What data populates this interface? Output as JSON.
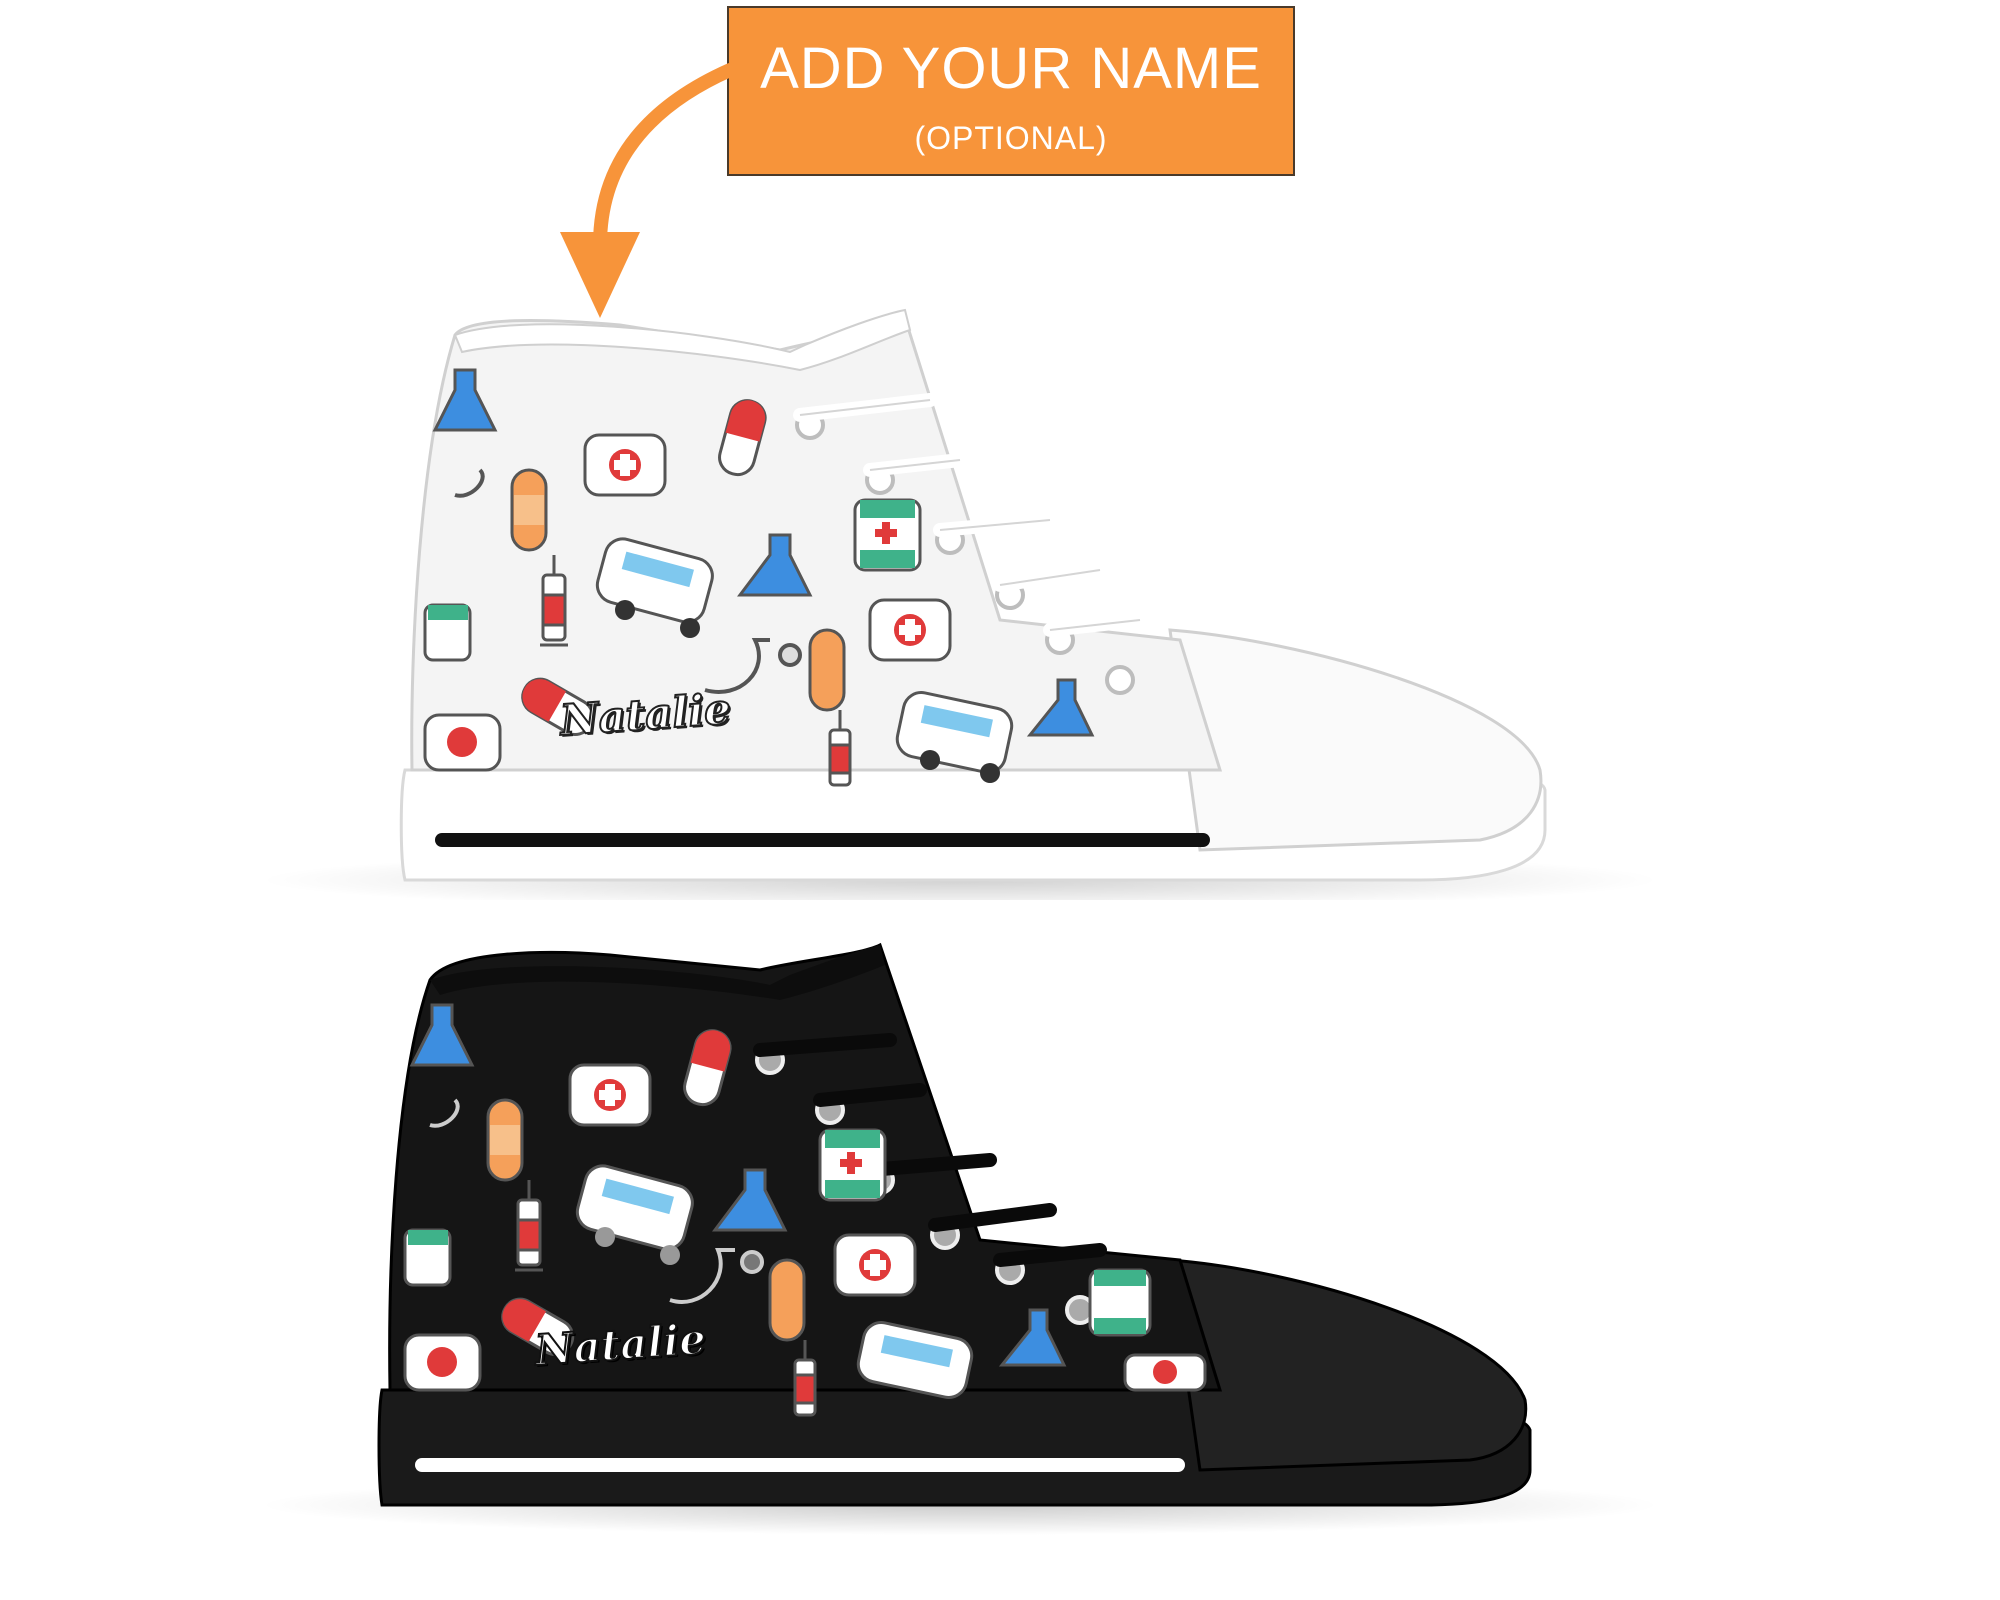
{
  "callout": {
    "title": "ADD YOUR NAME",
    "subtitle": "(OPTIONAL)",
    "color": "#f7943a"
  },
  "arrow": {
    "icon": "curved-arrow-down-icon",
    "color": "#f7943a"
  },
  "shoes": [
    {
      "variant": "white",
      "name_text": "Natalie",
      "upper_color": "#f4f4f4",
      "sole_color": "#ffffff",
      "stripe_color": "#111111"
    },
    {
      "variant": "black",
      "name_text": "Natalie",
      "upper_color": "#151515",
      "sole_color": "#1a1a1a",
      "stripe_color": "#ffffff"
    }
  ],
  "pattern_icons": [
    "first-aid-kit-icon",
    "pill-capsule-icon",
    "bandage-icon",
    "syringe-icon",
    "ambulance-icon",
    "flask-icon",
    "stethoscope-icon",
    "medicine-bottle-icon"
  ]
}
